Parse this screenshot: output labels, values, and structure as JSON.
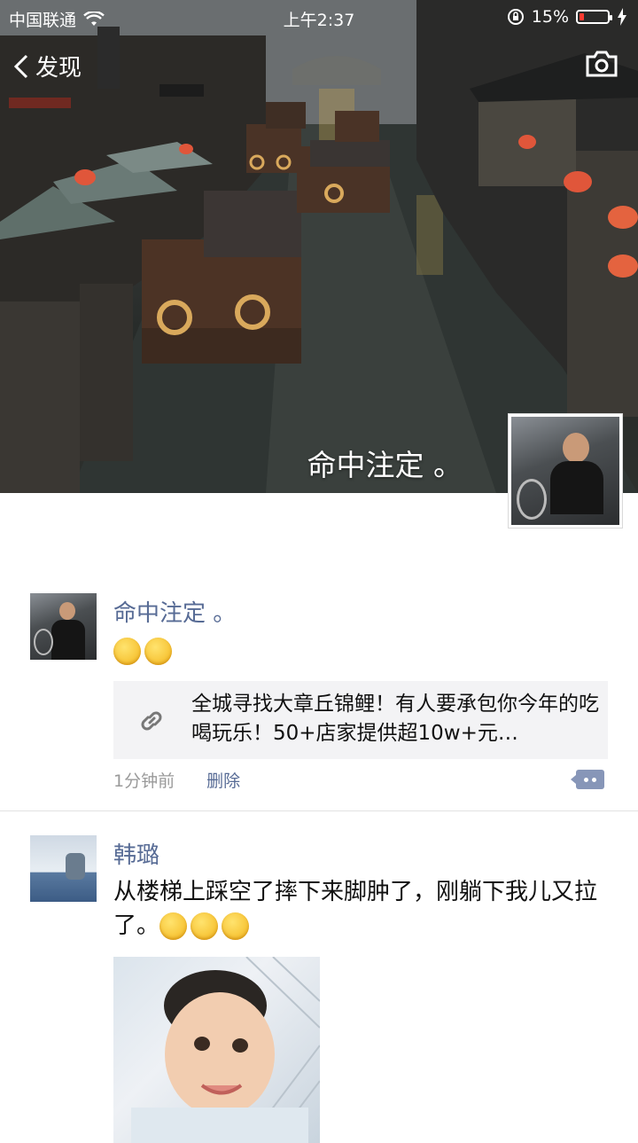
{
  "status_bar": {
    "carrier": "中国联通",
    "time": "上午2:37",
    "battery_percent": "15%",
    "battery_level": 0.15
  },
  "nav": {
    "back_label": "发现"
  },
  "cover": {
    "owner_name": "命中注定 。"
  },
  "posts": [
    {
      "name": "命中注定 。",
      "emoji_count": 2,
      "link_title": "全城寻找大章丘锦鲤！有人要承包你今年的吃喝玩乐！50+店家提供超10w+元…",
      "time": "1分钟前",
      "delete_label": "删除"
    },
    {
      "name": "韩璐",
      "text": "从楼梯上踩空了摔下来脚肿了，刚躺下我儿又拉了。",
      "emoji_count": 3
    }
  ],
  "colors": {
    "link_blue": "#576b95",
    "meta_gray": "#9a9a9a",
    "battery_red": "#ff3b30"
  }
}
